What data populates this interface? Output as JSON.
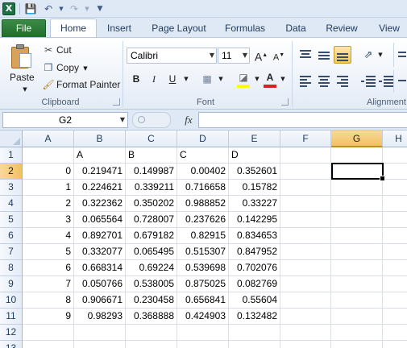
{
  "app": {
    "icon": "excel-icon",
    "file_tab": "File"
  },
  "qat": {
    "icons": [
      "excel-icon",
      "save-icon",
      "undo-icon",
      "redo-icon",
      "customize-qat-icon"
    ]
  },
  "tabs": [
    "Home",
    "Insert",
    "Page Layout",
    "Formulas",
    "Data",
    "Review",
    "View"
  ],
  "active_tab": "Home",
  "clipboard": {
    "group_label": "Clipboard",
    "paste_label": "Paste",
    "cut_label": "Cut",
    "copy_label": "Copy",
    "format_painter_label": "Format Painter"
  },
  "font": {
    "group_label": "Font",
    "font_name": "Calibri",
    "font_size": "11",
    "bold": "B",
    "italic": "I",
    "underline": "U",
    "grow": "A",
    "shrink": "A",
    "font_color_letter": "A",
    "highlight_color": "#ffff00",
    "font_color": "#e02020"
  },
  "alignment": {
    "group_label": "Alignment"
  },
  "formula_bar": {
    "name_box": "G2",
    "fx": "fx",
    "formula": ""
  },
  "columns": [
    "A",
    "B",
    "C",
    "D",
    "E",
    "F",
    "G",
    "H"
  ],
  "selected_column": "G",
  "rows": [
    "1",
    "2",
    "3",
    "4",
    "5",
    "6",
    "7",
    "8",
    "9",
    "10",
    "11",
    "12",
    "13"
  ],
  "selected_row": "2",
  "sheet": {
    "header_row": [
      "",
      "A",
      "B",
      "C",
      "D"
    ],
    "data": [
      [
        "0",
        "0.219471",
        "0.149987",
        "0.00402",
        "0.352601"
      ],
      [
        "1",
        "0.224621",
        "0.339211",
        "0.716658",
        "0.15782"
      ],
      [
        "2",
        "0.322362",
        "0.350202",
        "0.988852",
        "0.33227"
      ],
      [
        "3",
        "0.065564",
        "0.728007",
        "0.237626",
        "0.142295"
      ],
      [
        "4",
        "0.892701",
        "0.679182",
        "0.82915",
        "0.834653"
      ],
      [
        "5",
        "0.332077",
        "0.065495",
        "0.515307",
        "0.847952"
      ],
      [
        "6",
        "0.668314",
        "0.69224",
        "0.539698",
        "0.702076"
      ],
      [
        "7",
        "0.050766",
        "0.538005",
        "0.875025",
        "0.082769"
      ],
      [
        "8",
        "0.906671",
        "0.230458",
        "0.656841",
        "0.55604"
      ],
      [
        "9",
        "0.98293",
        "0.368888",
        "0.424903",
        "0.132482"
      ]
    ]
  }
}
